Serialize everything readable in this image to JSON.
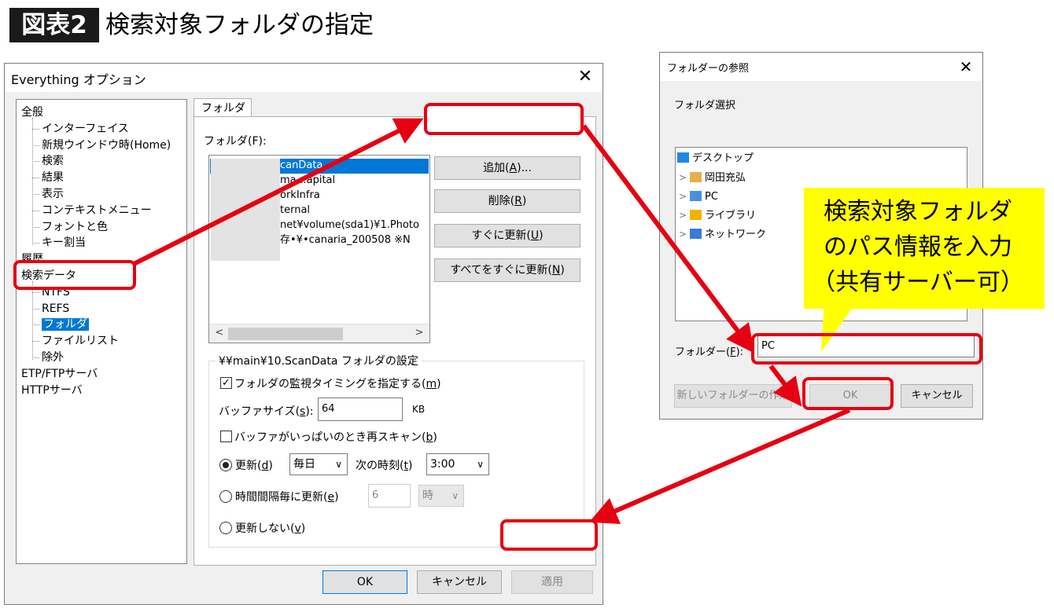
{
  "figure": {
    "badge": "図表2",
    "title": "検索対象フォルダの指定"
  },
  "main_dialog": {
    "title": "Everything オプション",
    "close_glyph": "✕",
    "tree": [
      {
        "label": "全般",
        "level": 0
      },
      {
        "label": "インターフェイス",
        "level": 1
      },
      {
        "label": "新規ウインドウ時(Home)",
        "level": 1
      },
      {
        "label": "検索",
        "level": 1
      },
      {
        "label": "結果",
        "level": 1
      },
      {
        "label": "表示",
        "level": 1
      },
      {
        "label": "コンテキストメニュー",
        "level": 1
      },
      {
        "label": "フォントと色",
        "level": 1
      },
      {
        "label": "キー割当",
        "level": 1
      },
      {
        "label": "履歴",
        "level": 0
      },
      {
        "label": "検索データ",
        "level": 0
      },
      {
        "label": "NTFS",
        "level": 1
      },
      {
        "label": "REFS",
        "level": 1
      },
      {
        "label": "フォルダ",
        "level": 1,
        "selected": true
      },
      {
        "label": "ファイルリスト",
        "level": 1
      },
      {
        "label": "除外",
        "level": 1
      },
      {
        "label": "ETP/FTPサーバ",
        "level": 0
      },
      {
        "label": "HTTPサーバ",
        "level": 0
      }
    ],
    "tab_label": "フォルダ",
    "folder_label": "フォルダ(F):",
    "folder_list": [
      "canData",
      "ma…apital",
      "orkInfra",
      "ternal",
      "net¥volume(sda1)¥1.Photo",
      "存•¥•canaria_200508  ※N"
    ],
    "scroll_left": "<",
    "scroll_right": ">",
    "buttons": {
      "add": {
        "text": "追加(",
        "key": "A",
        "tail": ")..."
      },
      "remove": {
        "text": "削除(",
        "key": "R",
        "tail": ")"
      },
      "update_now": {
        "text": "すぐに更新(",
        "key": "U",
        "tail": ")"
      },
      "update_all": {
        "text": "すべてをすぐに更新(",
        "key": "N",
        "tail": ")"
      }
    },
    "settings": {
      "group_title": "¥¥main¥10.ScanData フォルダの設定",
      "monitor_timing": {
        "text": "フォルダの監視タイミングを指定する(",
        "key": "m",
        "tail": ")",
        "checked": true
      },
      "buffer_label": {
        "text": "バッファサイズ(",
        "key": "s",
        "tail": "):"
      },
      "buffer_value": "64",
      "buffer_unit": "KB",
      "rescan": {
        "text": "バッファがいっぱいのとき再スキャン(",
        "key": "b",
        "tail": ")",
        "checked": false
      },
      "update_radio": {
        "text": "更新(",
        "key": "d",
        "tail": ")",
        "selected": true
      },
      "update_freq": "毎日",
      "next_time_label": {
        "text": "次の時刻(",
        "key": "t",
        "tail": ")"
      },
      "next_time_value": "3:00",
      "interval_radio": {
        "text": "時間間隔毎に更新(",
        "key": "e",
        "tail": ")",
        "selected": false
      },
      "interval_value": "6",
      "interval_unit": "時",
      "no_update_radio": {
        "text": "更新しない(",
        "key": "v",
        "tail": ")",
        "selected": false
      }
    },
    "footer": {
      "ok": "OK",
      "cancel": "キャンセル",
      "apply": "適用"
    }
  },
  "browse_dialog": {
    "title": "フォルダーの参照",
    "close_glyph": "✕",
    "description": "フォルダ選択",
    "tree": [
      {
        "label": "デスクトップ",
        "expander": "",
        "icon_color": "#1e88e5"
      },
      {
        "label": "岡田充弘",
        "expander": ">",
        "icon_color": "#e8b04a"
      },
      {
        "label": "PC",
        "expander": ">",
        "icon_color": "#4a90d9"
      },
      {
        "label": "ライブラリ",
        "expander": ">",
        "icon_color": "#f0b400"
      },
      {
        "label": "ネットワーク",
        "expander": ">",
        "icon_color": "#3a7bd5"
      }
    ],
    "folder_label": {
      "text": "フォルダー(",
      "key": "F",
      "tail": "):"
    },
    "folder_value": "PC",
    "new_folder": "新しいフォルダーの作成",
    "ok": "OK",
    "cancel": "キャンセル"
  },
  "callout": {
    "lines": [
      "検索対象フォルダ",
      "のパス情報を入力",
      "（共有サーバー可）"
    ]
  },
  "colors": {
    "highlight": "#e60012",
    "callout": "#ffff00",
    "selection": "#0078d7"
  }
}
